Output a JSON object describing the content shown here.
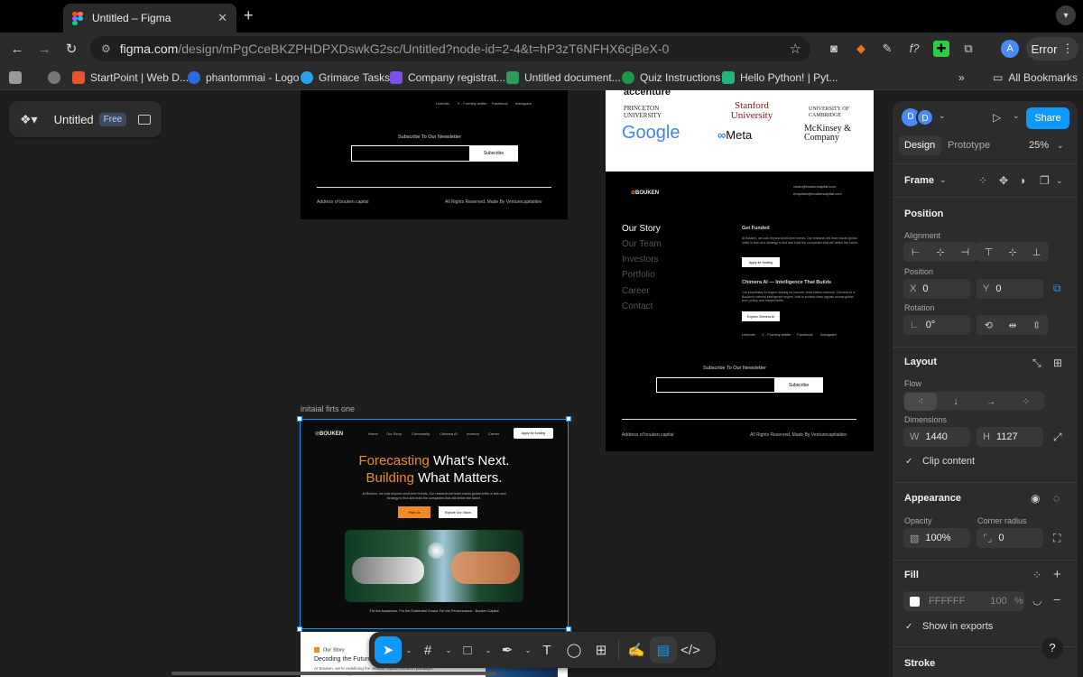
{
  "browser": {
    "tab_title": "Untitled – Figma",
    "new_tab": "+",
    "tab_close": "✕",
    "url_main": "figma.com",
    "url_rest": "/design/mPgCceBKZPHDPXDswkG2sc/Untitled?node-id=2-4&t=hP3zT6NFHX6cjBeX-0",
    "profile_initial": "A",
    "error_label": "Error"
  },
  "bookmarks": [
    {
      "label": "StartPoint | Web D...",
      "color": "#e8542a"
    },
    {
      "label": "phantommai - Logo",
      "color": "#2d6cdf"
    },
    {
      "label": "Grimace Tasks",
      "color": "#2aa0e8"
    },
    {
      "label": "Company registrat...",
      "color": "#7b4ff0"
    },
    {
      "label": "Untitled document...",
      "color": "#2a9d57"
    },
    {
      "label": "Quiz Instructions",
      "color": "#1b9b4a"
    },
    {
      "label": "Hello Python! | Pyt...",
      "color": "#1fb87a"
    }
  ],
  "bookmarks_more": "»",
  "bookmarks_all": "All Bookmarks",
  "file": {
    "name": "Untitled",
    "plan": "Free"
  },
  "frame_top_left": {
    "social": [
      "Linkedin",
      "X - Formely twitter",
      "Facebook",
      "Instagram"
    ],
    "newsletter": "Subscribe To Our Newsletter",
    "subscribe": "Subscribe",
    "address": "Address of bouken capital",
    "rights": "All Rights Reserved. Made By Venturecapitaldev"
  },
  "frame_right": {
    "logos_partial_top": "accenture",
    "logos": [
      "PRINCETON UNIVERSITY",
      "Stanford University",
      "UNIVERSITY OF CAMBRIDGE",
      "Google",
      "Meta",
      "McKinsey & Company"
    ],
    "brand": "BOUKEN",
    "emails": [
      "vinao@boukencapital.com",
      "enquiries@boukencapital.com"
    ],
    "nav": [
      "Our Story",
      "Our Team",
      "Investors",
      "Portfolio",
      "Career",
      "Contact"
    ],
    "get_funded_title": "Get Funded",
    "get_funded_text": "At Bouken, we look beyond short-term trends. Our research-led team tracks global shifts in tech and strategy to find and build the companies that will define the future.",
    "apply_btn": "Apply for funding",
    "chimera_title": "Chimera AI — Intelligence That Builds",
    "chimera_text": "Our proprietary AI engine helping us uncover what others overlook. Chimera AI is Bouken's internal intelligence engine, built to surface deep signals across global tech, policy, and market shifts.",
    "explore_btn": "Explore Chimera AI",
    "social": [
      "Linkedin",
      "X - Formely twitter",
      "Facebook",
      "Instagram"
    ],
    "newsletter": "Subscribe To Our Newsletter",
    "subscribe": "Subscribe",
    "address": "Address of bouken capital",
    "rights": "All Rights Reserved. Made By Venturecapitaldev"
  },
  "frame_selected": {
    "label": "initaial firts one",
    "brand": "BOUKEN",
    "nav": [
      "Home",
      "Our Story",
      "Community",
      "Chimera AI",
      "Investor",
      "Career"
    ],
    "apply_btn": "Apply for funding",
    "headline_1_accent": "Forecasting",
    "headline_1_rest": " What's Next.",
    "headline_2_accent": "Building",
    "headline_2_rest": " What Matters.",
    "intro": "At Bouken, we look beyond short-term trends. Our research-led team tracks global shifts in tech and strategy to find and build the companies that will define the future.",
    "cta_primary": "Pitch Us",
    "cta_secondary": "Explore Our Vision",
    "tagline": "For the Audacious, For the Existential Crowd, For the Perseverance - Bouken Capital"
  },
  "frame_bottom": {
    "badge": "Our Story",
    "heading": "Decoding the Future",
    "text": "At Bouken, we're redefining the venture capital research paradigm. With an inclusive approach"
  },
  "toolbar_accent": "#0d99ff",
  "panel": {
    "avatars": [
      "D",
      "D"
    ],
    "share": "Share",
    "tabs": [
      "Design",
      "Prototype"
    ],
    "zoom": "25%",
    "frame_label": "Frame",
    "position_title": "Position",
    "alignment_label": "Alignment",
    "position_label": "Position",
    "x_prefix": "X",
    "x_value": "0",
    "y_prefix": "Y",
    "y_value": "0",
    "rotation_label": "Rotation",
    "rotation_value": "0°",
    "layout_title": "Layout",
    "flow_label": "Flow",
    "dimensions_label": "Dimensions",
    "w_prefix": "W",
    "w_value": "1440",
    "h_prefix": "H",
    "h_value": "1127",
    "clip_content": "Clip content",
    "appearance_title": "Appearance",
    "opacity_label": "Opacity",
    "opacity_value": "100%",
    "radius_label": "Corner radius",
    "radius_value": "0",
    "fill_title": "Fill",
    "fill_hex": "FFFFFF",
    "fill_opacity": "100",
    "fill_pct": "%",
    "show_exports": "Show in exports",
    "stroke_title": "Stroke"
  },
  "help": "?"
}
